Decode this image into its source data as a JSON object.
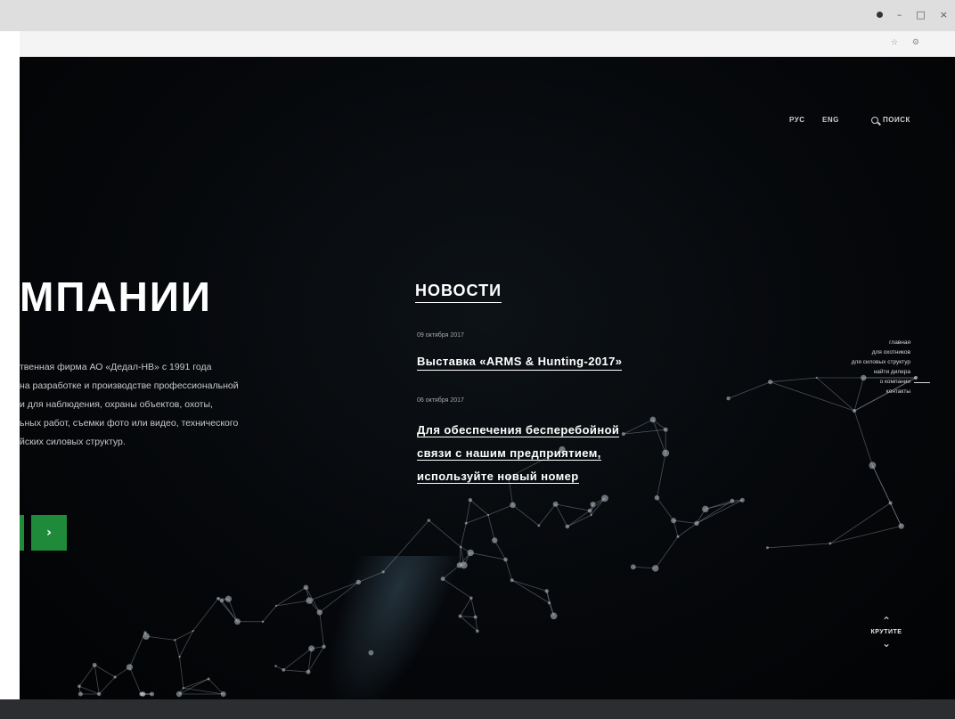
{
  "browser": {
    "window_controls": [
      "●",
      "–",
      "□",
      "×"
    ],
    "addr_icons": [
      "☆",
      "⚙"
    ]
  },
  "header": {
    "lang_ru": "РУС",
    "lang_en": "ENG",
    "search_label": "ПОИСК"
  },
  "hero": {
    "headline": "МПАНИИ",
    "description_lines": [
      "твенная фирма АО «Дедал-НВ» с 1991 года",
      "на разработке и производстве профессиональной",
      "и для наблюдения, охраны объектов, охоты,",
      "ьных работ, съемки фото или видео, технического",
      "йских силовых структур."
    ],
    "next_button": "›"
  },
  "news": {
    "title": "НОВОСТИ",
    "items": [
      {
        "date": "09 октября 2017",
        "headline": "Выставка «ARMS & Hunting-2017»"
      },
      {
        "date": "06 октября 2017",
        "headline_lines": [
          "Для обеспечения бесперебойной",
          "связи с нашим предприятием,",
          "используйте новый номер"
        ]
      }
    ]
  },
  "side_nav": [
    "главная",
    "для охотников",
    "для силовых структур",
    "найти дилера",
    "о компании",
    "контакты"
  ],
  "scroll": {
    "up": "⌃",
    "label": "КРУТИТЕ",
    "down": "⌄"
  }
}
